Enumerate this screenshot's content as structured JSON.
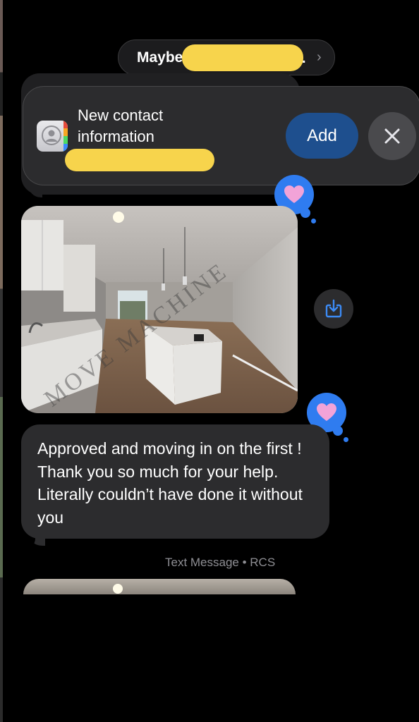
{
  "conversation": {
    "contact_name_visible": "Maybe",
    "contact_name_suffix": ".",
    "chevron_icon": "chevron-right-icon"
  },
  "banner": {
    "title": "New contact information",
    "add_label": "Add",
    "close_icon": "close-icon",
    "contact_icon": "contacts-app-icon"
  },
  "photo_message": {
    "watermark": "MOVE MACHINE",
    "reaction": "heart"
  },
  "message": {
    "text": "Approved and moving in on the first ! Thank you so much for your help. Literally couldn’t have done it without you",
    "reaction": "heart"
  },
  "service_label": "Text Message • RCS",
  "colors": {
    "reaction_blue": "#2f7cf0",
    "add_button": "#1e4f8e",
    "bubble_gray": "#2c2c2e",
    "redaction_yellow": "#f7d44c",
    "heart_pink": "#f2a3d8"
  }
}
